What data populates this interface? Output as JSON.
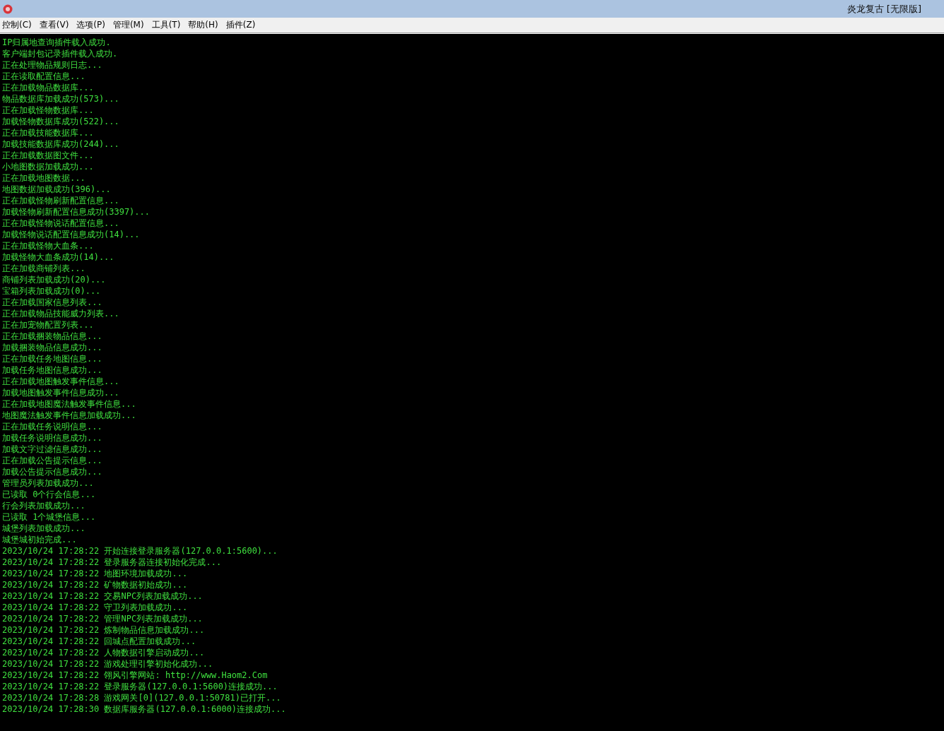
{
  "window": {
    "title": "炎龙复古 [无限版]"
  },
  "menu": [
    "控制(C)",
    "查看(V)",
    "选项(P)",
    "管理(M)",
    "工具(T)",
    "帮助(H)",
    "插件(Z)"
  ],
  "console": {
    "lines": [
      "IP归属地查询插件载入成功.",
      "客户端封包记录插件载入成功.",
      "正在处理物品规则日志...",
      "正在读取配置信息...",
      "正在加载物品数据库...",
      "物品数据库加载成功(573)...",
      "正在加载怪物数据库...",
      "加载怪物数据库成功(522)...",
      "正在加载技能数据库...",
      "加载技能数据库成功(244)...",
      "正在加载数据图文件...",
      "小地图数据加载成功...",
      "正在加载地图数据...",
      "地图数据加载成功(396)...",
      "正在加载怪物刷新配置信息...",
      "加载怪物刷新配置信息成功(3397)...",
      "正在加载怪物说话配置信息...",
      "加载怪物说话配置信息成功(14)...",
      "正在加载怪物大血条...",
      "加载怪物大血条成功(14)...",
      "正在加载商铺列表...",
      "商铺列表加载成功(20)...",
      "宝箱列表加载成功(0)...",
      "正在加载国家信息列表...",
      "正在加载物品技能威力列表...",
      "正在加宠物配置列表...",
      "正在加载捆装物品信息...",
      "加载捆装物品信息成功...",
      "正在加载任务地图信息...",
      "加载任务地图信息成功...",
      "正在加载地图触发事件信息...",
      "加载地图触发事件信息成功...",
      "正在加载地图魔法触发事件信息...",
      "地图魔法触发事件信息加载成功...",
      "正在加载任务说明信息...",
      "加载任务说明信息成功...",
      "加载文字过滤信息成功...",
      "正在加载公告提示信息...",
      "加载公告提示信息成功...",
      "管理员列表加载成功...",
      "已读取 0个行会信息...",
      "行会列表加载成功...",
      "已读取 1个城堡信息...",
      "城堡列表加载成功...",
      "城堡城初始完成...",
      "2023/10/24 17:28:22 开始连接登录服务器(127.0.0.1:5600)...",
      "2023/10/24 17:28:22 登录服务器连接初始化完成...",
      "2023/10/24 17:28:22 地图环境加载成功...",
      "2023/10/24 17:28:22 矿物数据初始成功...",
      "2023/10/24 17:28:22 交易NPC列表加载成功...",
      "2023/10/24 17:28:22 守卫列表加载成功...",
      "2023/10/24 17:28:22 管理NPC列表加载成功...",
      "2023/10/24 17:28:22 炼制物品信息加载成功...",
      "2023/10/24 17:28:22 回城点配置加载成功...",
      "2023/10/24 17:28:22 人物数据引擎启动成功...",
      "2023/10/24 17:28:22 游戏处理引擎初始化成功...",
      "2023/10/24 17:28:22 翎风引擎网站: http://www.Haom2.Com",
      "2023/10/24 17:28:22 登录服务器(127.0.0.1:5600)连接成功...",
      "2023/10/24 17:28:28 游戏网关[0](127.0.0.1:50781)已打开...",
      "2023/10/24 17:28:30 数据库服务器(127.0.0.1:6000)连接成功..."
    ]
  }
}
